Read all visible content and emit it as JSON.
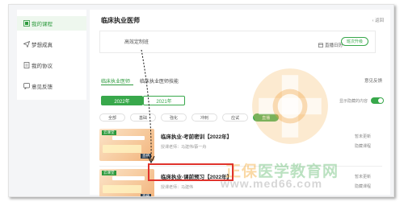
{
  "sidebar": {
    "items": [
      {
        "label": "我的课程",
        "icon": "grid-icon",
        "active": true
      },
      {
        "label": "梦想成真",
        "icon": "send-icon",
        "active": false
      },
      {
        "label": "我的协议",
        "icon": "document-icon",
        "active": false
      },
      {
        "label": "意见反馈",
        "icon": "feedback-icon",
        "active": false
      }
    ]
  },
  "header": {
    "title": "临床执业医师",
    "back": "返回"
  },
  "class_box": {
    "name": "高效定制班",
    "live_calendar": "直播日历",
    "upgrade": "班次升级"
  },
  "tabs": [
    {
      "label": "临床执业医师",
      "active": true
    },
    {
      "label": "临床执业医师技能",
      "active": false
    }
  ],
  "feedback": "意见反馈",
  "years": [
    {
      "label": "2022年",
      "active": true
    },
    {
      "label": "2021年",
      "active": false
    }
  ],
  "toggle": {
    "label": "显示隐藏的内容",
    "on": true
  },
  "filters": [
    {
      "label": "全部",
      "active": false
    },
    {
      "label": "基础",
      "active": false
    },
    {
      "label": "強化",
      "active": false
    },
    {
      "label": "冲刺",
      "active": false
    },
    {
      "label": "应试",
      "active": false
    },
    {
      "label": "直播",
      "active": true
    }
  ],
  "courses": [
    {
      "title": "临床执业-考前密训【2022年】",
      "meta": "授课老师：马建伟/蔡一舟",
      "status": [
        "暂未更新",
        "隐藏课程"
      ],
      "thumb_tag": "直播",
      "thumb_brand": "云课堂"
    },
    {
      "title": "临床执业-课前预习【2022年】",
      "meta": "授课老师：马建伟",
      "status": [
        "暂未更新",
        "隐藏课程"
      ],
      "thumb_tag": "直播",
      "thumb_brand": "云课堂"
    }
  ],
  "watermark": {
    "text_orange": "正保",
    "text_green": "医学教育网",
    "url": "www.med66.com"
  },
  "colors": {
    "accent": "#38a84b",
    "highlight": "#e0332c"
  }
}
